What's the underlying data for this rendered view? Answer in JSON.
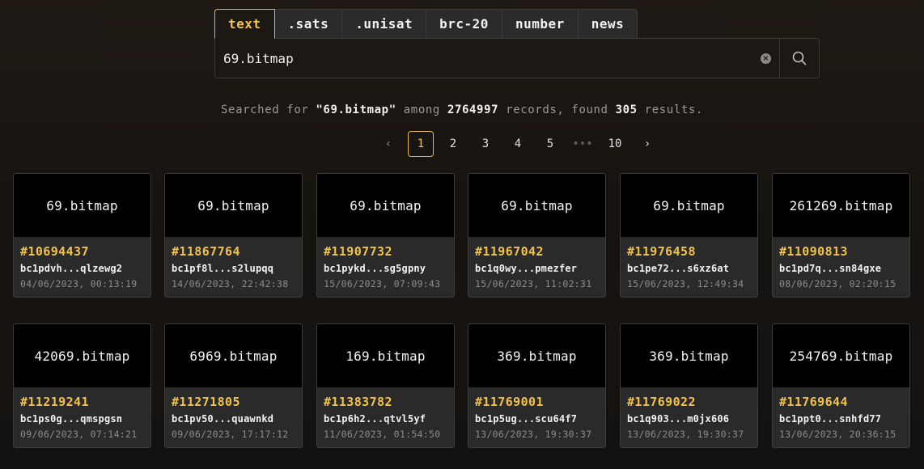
{
  "tabs": [
    "text",
    ".sats",
    ".unisat",
    "brc-20",
    "number",
    "news"
  ],
  "search": {
    "value": "69.bitmap"
  },
  "summary": {
    "prefix": "Searched for ",
    "query": "\"69.bitmap\"",
    "among": " among ",
    "records": "2764997",
    "records_label": " records, found ",
    "results": "305",
    "results_label": " results."
  },
  "pagination": {
    "prev": "‹",
    "pages": [
      "1",
      "2",
      "3",
      "4",
      "5",
      "•••",
      "10"
    ],
    "next": "›",
    "current": "1"
  },
  "cards": [
    {
      "title": "69.bitmap",
      "number": "#10694437",
      "address": "bc1pdvh...qlzewg2",
      "date": "04/06/2023, 00:13:19"
    },
    {
      "title": "69.bitmap",
      "number": "#11867764",
      "address": "bc1pf8l...s2lupqq",
      "date": "14/06/2023, 22:42:38"
    },
    {
      "title": "69.bitmap",
      "number": "#11907732",
      "address": "bc1pykd...sg5gpny",
      "date": "15/06/2023, 07:09:43"
    },
    {
      "title": "69.bitmap",
      "number": "#11967042",
      "address": "bc1q0wy...pmezfer",
      "date": "15/06/2023, 11:02:31"
    },
    {
      "title": "69.bitmap",
      "number": "#11976458",
      "address": "bc1pe72...s6xz6at",
      "date": "15/06/2023, 12:49:34"
    },
    {
      "title": "261269.bitmap",
      "number": "#11090813",
      "address": "bc1pd7q...sn84gxe",
      "date": "08/06/2023, 02:20:15"
    },
    {
      "title": "42069.bitmap",
      "number": "#11219241",
      "address": "bc1ps0g...qmspgsn",
      "date": "09/06/2023, 07:14:21"
    },
    {
      "title": "6969.bitmap",
      "number": "#11271805",
      "address": "bc1pv50...quawnkd",
      "date": "09/06/2023, 17:17:12"
    },
    {
      "title": "169.bitmap",
      "number": "#11383782",
      "address": "bc1p6h2...qtvl5yf",
      "date": "11/06/2023, 01:54:50"
    },
    {
      "title": "369.bitmap",
      "number": "#11769001",
      "address": "bc1p5ug...scu64f7",
      "date": "13/06/2023, 19:30:37"
    },
    {
      "title": "369.bitmap",
      "number": "#11769022",
      "address": "bc1q903...m0jx606",
      "date": "13/06/2023, 19:30:37"
    },
    {
      "title": "254769.bitmap",
      "number": "#11769644",
      "address": "bc1ppt0...snhfd77",
      "date": "13/06/2023, 20:36:15"
    }
  ]
}
